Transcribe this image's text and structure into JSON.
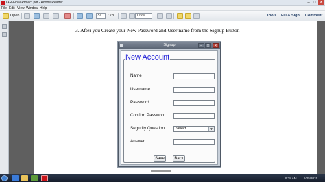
{
  "window": {
    "title": "IAR-Final-Project.pdf - Adobe Reader",
    "controls": [
      "–",
      "□",
      "✕"
    ]
  },
  "menu": [
    "File",
    "Edit",
    "View",
    "Window",
    "Help"
  ],
  "toolbar": {
    "open_label": "Open",
    "page_current": "32",
    "page_total": "/ 78",
    "zoom": "125%",
    "right_buttons": [
      "Tools",
      "Fill & Sign",
      "Comment"
    ]
  },
  "document": {
    "step_text": "3.   After you Create your New Password and User name from the Signup Button"
  },
  "dialog": {
    "title": "Signup",
    "controls": [
      "–",
      "□",
      "✕"
    ],
    "heading": "New Account",
    "fields": [
      {
        "label": "Name",
        "value": ""
      },
      {
        "label": "Username",
        "value": ""
      },
      {
        "label": "Password",
        "value": ""
      },
      {
        "label": "Confirm Password",
        "value": ""
      },
      {
        "label": "Segurity Question",
        "value": "Select"
      },
      {
        "label": "Answer",
        "value": ""
      }
    ],
    "buttons": {
      "save": "Save",
      "back": "Back"
    }
  },
  "taskbar": {
    "time": "9:28 AM",
    "date": "6/25/2015"
  },
  "icons": {
    "app": "adobe-reader-icon",
    "accent": "#c8141a",
    "legend_color": "#1c1cd6"
  }
}
